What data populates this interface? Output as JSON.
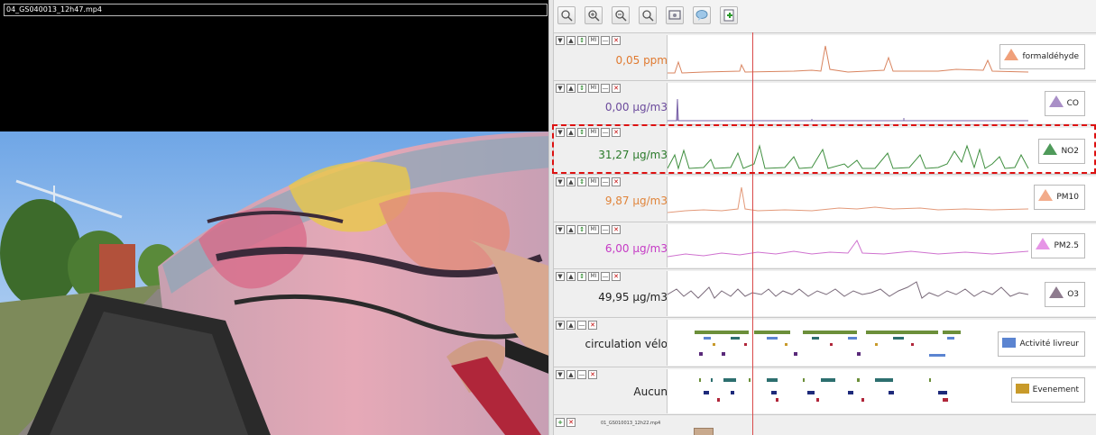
{
  "video": {
    "filename": "04_GS040013_12h47.mp4"
  },
  "toolbar": {
    "buttons": [
      "zoom-in-icon",
      "zoom-in-plus-icon",
      "zoom-out-icon",
      "zoom-reset-icon",
      "screenshot-icon",
      "comment-icon",
      "add-track-icon"
    ]
  },
  "tracks": [
    {
      "value": "0,05 ppm",
      "value_color": "#e07a30",
      "legend": "formaldéhyde",
      "color": "#f0a07a",
      "line": "#d9845f"
    },
    {
      "value": "0,00 µg/m3",
      "value_color": "#6b4a9c",
      "legend": "CO",
      "color": "#a98fc7",
      "line": "#7a64a8"
    },
    {
      "value": "31,27 µg/m3",
      "value_color": "#2a7a2a",
      "legend": "NO2",
      "color": "#4f9a5a",
      "line": "#3f8f3f"
    },
    {
      "value": "9,87 µg/m3",
      "value_color": "#e0843a",
      "legend": "PM10",
      "color": "#f2ab8a",
      "line": "#e39a7a"
    },
    {
      "value": "6,00 µg/m3",
      "value_color": "#c53ac5",
      "legend": "PM2.5",
      "color": "#e695e6",
      "line": "#cf72cf"
    },
    {
      "value": "49,95 µg/m3",
      "value_color": "#222222",
      "legend": "O3",
      "color": "#8e7b8e",
      "line": "#7a6a7a"
    },
    {
      "value": "circulation vélo",
      "value_color": "#222222",
      "legend": "Activité livreur",
      "color": "#5b84d1"
    },
    {
      "value": "Aucun",
      "value_color": "#222222",
      "legend": "Evenement",
      "color": "#c89a2a"
    }
  ],
  "ctrl_labels": {
    "down": "▼",
    "up": "▲",
    "mi": "MI",
    "minus": "—",
    "close": "✕",
    "add": "+"
  },
  "footer": {
    "clip_name": "01_GS010013_12h22.mp4"
  }
}
